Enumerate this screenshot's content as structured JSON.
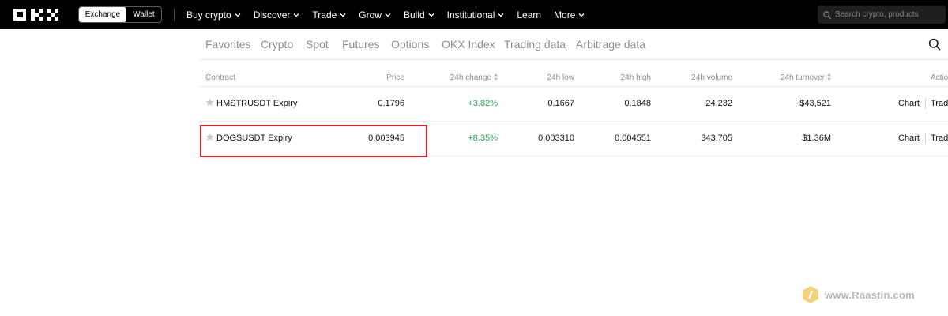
{
  "header": {
    "switch": {
      "exchange_label": "Exchange",
      "wallet_label": "Wallet"
    },
    "nav": [
      {
        "label": "Buy crypto",
        "dropdown": true
      },
      {
        "label": "Discover",
        "dropdown": true
      },
      {
        "label": "Trade",
        "dropdown": true
      },
      {
        "label": "Grow",
        "dropdown": true
      },
      {
        "label": "Build",
        "dropdown": true
      },
      {
        "label": "Institutional",
        "dropdown": true
      },
      {
        "label": "Learn",
        "dropdown": false
      },
      {
        "label": "More",
        "dropdown": true
      }
    ],
    "search": {
      "placeholder": "Search crypto, products"
    }
  },
  "subtabs": [
    "Favorites",
    "Crypto",
    "Spot",
    "Futures",
    "Options",
    "OKX Index",
    "Trading data",
    "Arbitrage data"
  ],
  "table": {
    "headers": {
      "contract": "Contract",
      "price": "Price",
      "change": "24h change",
      "low": "24h low",
      "high": "24h high",
      "volume": "24h volume",
      "turnover": "24h turnover",
      "action": "Actio"
    },
    "rows": [
      {
        "contract": "HMSTRUSDT Expiry",
        "price": "0.1796",
        "change": "+3.82%",
        "low": "0.1667",
        "high": "0.1848",
        "volume": "24,232",
        "turnover": "$43,521",
        "chart": "Chart",
        "trade": "Trad"
      },
      {
        "contract": "DOGSUSDT Expiry",
        "price": "0.003945",
        "change": "+8.35%",
        "low": "0.003310",
        "high": "0.004551",
        "volume": "343,705",
        "turnover": "$1.36M",
        "chart": "Chart",
        "trade": "Trad"
      }
    ]
  },
  "watermark": {
    "text": "www.Raastin.com"
  },
  "colors": {
    "topbar": "#000000",
    "positive": "#25a750",
    "highlight": "#d9232d"
  }
}
